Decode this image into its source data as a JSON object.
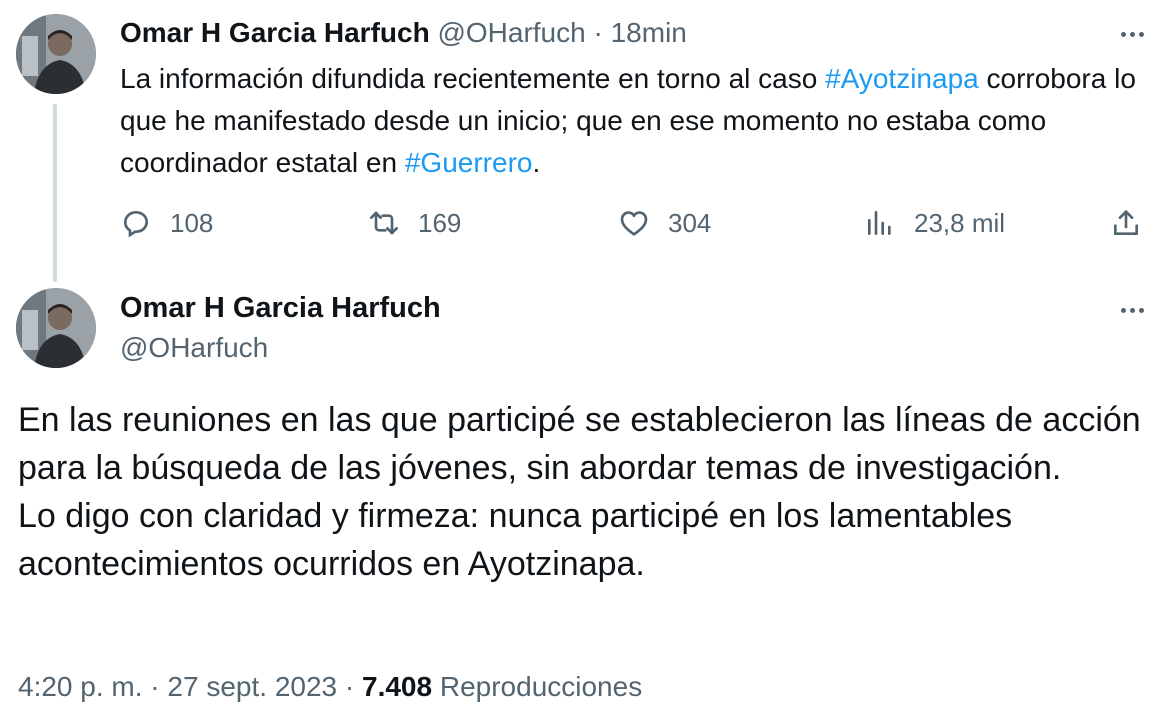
{
  "reply_tweet": {
    "author_name": "Omar H Garcia Harfuch",
    "handle": "@OHarfuch",
    "separator": "·",
    "time": "18min",
    "text_1": "La información difundida recientemente en torno al caso ",
    "hashtag_1": "#Ayotzinapa",
    "text_2": " corrobora lo que he manifestado desde un inicio; que en ese momento no estaba como coordinador estatal en ",
    "hashtag_2": "#Guerrero",
    "text_3": ".",
    "replies": "108",
    "retweets": "169",
    "likes": "304",
    "views": "23,8 mil"
  },
  "main_tweet": {
    "author_name": "Omar H Garcia Harfuch",
    "handle": "@OHarfuch",
    "paragraph_1": "En las reuniones en las que participé se establecieron las líneas de acción para la búsqueda de las jóvenes, sin abordar temas de investigación.",
    "paragraph_2": "Lo digo con claridad y firmeza: nunca participé en los lamentables acontecimientos ocurridos en Ayotzinapa.",
    "time": "4:20 p. m.",
    "sep_1": " · ",
    "date": "27 sept. 2023",
    "sep_2": " · ",
    "views_count": "7.408",
    "views_label": " Reproducciones"
  },
  "colors": {
    "text": "#0f1419",
    "muted": "#536471",
    "link": "#1d9bf0",
    "thread_line": "#cfd9de"
  },
  "icons": {
    "reply": "reply-icon",
    "retweet": "retweet-icon",
    "like": "heart-icon",
    "views": "analytics-icon",
    "share": "share-icon",
    "more": "more-icon"
  }
}
